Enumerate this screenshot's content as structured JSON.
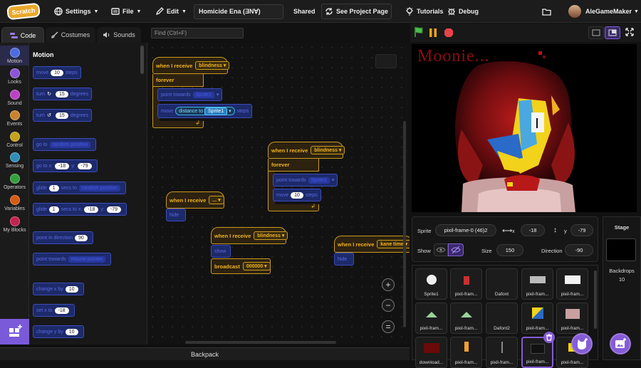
{
  "menu": {
    "logo": "Scratch",
    "settings": "Settings",
    "file": "File",
    "edit": "Edit",
    "project_title": "Homicide Ena (ƎN∀)",
    "shared": "Shared",
    "see_project": "See Project Page",
    "tutorials": "Tutorials",
    "debug": "Debug",
    "username": "AleGameMaker"
  },
  "tabs": {
    "code": "Code",
    "costumes": "Costumes",
    "sounds": "Sounds"
  },
  "find_placeholder": "Find (Ctrl+F)",
  "categories": [
    {
      "label": "Motion",
      "color": "#4c6cdf"
    },
    {
      "label": "Looks",
      "color": "#8a55d7"
    },
    {
      "label": "Sound",
      "color": "#bb42c3"
    },
    {
      "label": "Events",
      "color": "#c88330"
    },
    {
      "label": "Control",
      "color": "#c4a31a"
    },
    {
      "label": "Sensing",
      "color": "#2e8eb8"
    },
    {
      "label": "Operators",
      "color": "#359f3f"
    },
    {
      "label": "Variables",
      "color": "#d65b14"
    },
    {
      "label": "My Blocks",
      "color": "#c3234f"
    }
  ],
  "palette": {
    "title": "Motion",
    "blocks": [
      {
        "pre": "move",
        "num": "10",
        "post": "steps"
      },
      {
        "pre": "turn",
        "num": "15",
        "post": "degrees"
      },
      {
        "pre": "turn",
        "num": "15",
        "post": "degrees"
      },
      {
        "pre": "go to",
        "dd": "random position"
      },
      {
        "pre": "go to x:",
        "num": "-18",
        "post": "y:",
        "num2": "-79"
      },
      {
        "pre": "glide",
        "num": "1",
        "post": "secs to",
        "dd": "random position"
      },
      {
        "pre": "glide",
        "num": "1",
        "post": "secs to x:",
        "num2": "-18",
        "post2": "y:",
        "num3": "-79"
      },
      {
        "pre": "point in direction",
        "num": "90"
      },
      {
        "pre": "point towards",
        "dd": "mouse-pointer"
      },
      {
        "pre": "change x by",
        "num": "10"
      },
      {
        "pre": "set x to",
        "num": "-18"
      },
      {
        "pre": "change y by",
        "num": "10"
      }
    ]
  },
  "scripts": {
    "s1": {
      "hat": "when I receive",
      "msg": "blindness",
      "forever": "forever",
      "b1": "point towards",
      "b1dd": "Sprite1",
      "b2": "move",
      "b2r": "distance to",
      "b2dd": "Sprite1",
      "b2post": "steps"
    },
    "s2": {
      "hat": "when I receive",
      "msg": "blindness",
      "forever": "forever",
      "b1": "point towards",
      "b1dd": "Sprite1",
      "b2": "move",
      "b2num": "10",
      "b2post": "steps"
    },
    "s3": {
      "hat": "when I receive",
      "msg": "...",
      "b1": "hide"
    },
    "s4": {
      "hat": "when I receive",
      "msg": "blindness",
      "b1": "show",
      "b2": "broadcast",
      "b2dd": "000000"
    },
    "s5": {
      "hat": "when I receive",
      "msg": "kane time",
      "b1": "hide"
    }
  },
  "zoom": {
    "in": "+",
    "out": "−",
    "reset": "="
  },
  "backpack": "Backpack",
  "stage": {
    "overlay_text": "Moonie..."
  },
  "sprite_info": {
    "sprite_label": "Sprite",
    "sprite_name": "pixil-frame-0 (46)2",
    "x_label": "x",
    "x": "-18",
    "y_label": "y",
    "y": "-79",
    "show_label": "Show",
    "size_label": "Size",
    "size": "150",
    "direction_label": "Direction",
    "direction": "-90"
  },
  "sprites": [
    {
      "name": "Sprite1"
    },
    {
      "name": "pixil-fram..."
    },
    {
      "name": "Dafont"
    },
    {
      "name": "pixil-fram..."
    },
    {
      "name": "pixil-fram..."
    },
    {
      "name": "pixil-fram..."
    },
    {
      "name": "pixil-fram..."
    },
    {
      "name": "Dafont2"
    },
    {
      "name": "pixil-fram..."
    },
    {
      "name": "pixil-fram..."
    },
    {
      "name": "download..."
    },
    {
      "name": "pixil-fram..."
    },
    {
      "name": "pixil-fram..."
    },
    {
      "name": "pixil-fram..."
    },
    {
      "name": "pixil-fram..."
    }
  ],
  "stage_panel": {
    "label": "Stage",
    "backdrops_label": "Backdrops",
    "backdrops": "10"
  }
}
